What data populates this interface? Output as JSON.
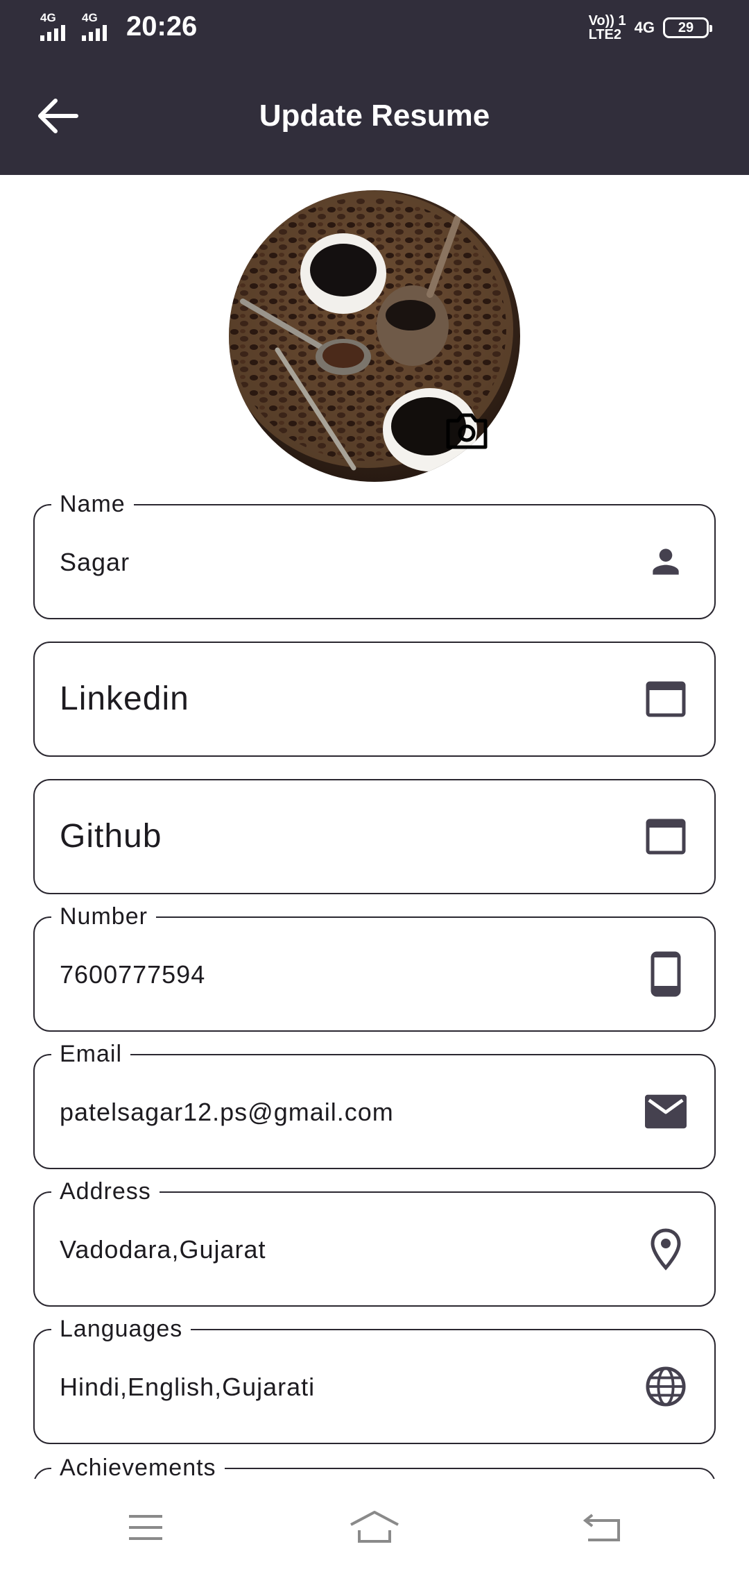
{
  "status_bar": {
    "sim1_tag": "4G",
    "sim2_tag": "4G",
    "time": "20:26",
    "volte_top": "Vo)) 1",
    "volte_bottom": "LTE2",
    "network": "4G",
    "battery": "29"
  },
  "app_bar": {
    "title": "Update Resume",
    "back_icon": "arrow-back-icon"
  },
  "avatar": {
    "image": "coffee-cups-photo",
    "camera_icon": "camera-icon"
  },
  "fields": {
    "name": {
      "label": "Name",
      "value": "Sagar",
      "icon": "person-icon"
    },
    "linkedin": {
      "placeholder": "Linkedin",
      "icon": "web-window-icon"
    },
    "github": {
      "placeholder": "Github",
      "icon": "web-window-icon"
    },
    "number": {
      "label": "Number",
      "value": "7600777594",
      "icon": "phone-icon"
    },
    "email": {
      "label": "Email",
      "value": "patelsagar12.ps@gmail.com",
      "icon": "mail-icon"
    },
    "address": {
      "label": "Address",
      "value": "Vadodara,Gujarat",
      "icon": "location-pin-icon"
    },
    "languages": {
      "label": "Languages",
      "value": "Hindi,English,Gujarati",
      "icon": "globe-icon"
    },
    "achievements": {
      "label": "Achievements"
    }
  },
  "nav_bar": {
    "menu_icon": "menu-icon",
    "home_icon": "home-icon",
    "back_icon": "back-icon"
  },
  "colors": {
    "header": "#312e3b",
    "text": "#1d1b20",
    "outline": "#2a2730",
    "icon": "#45414f"
  }
}
